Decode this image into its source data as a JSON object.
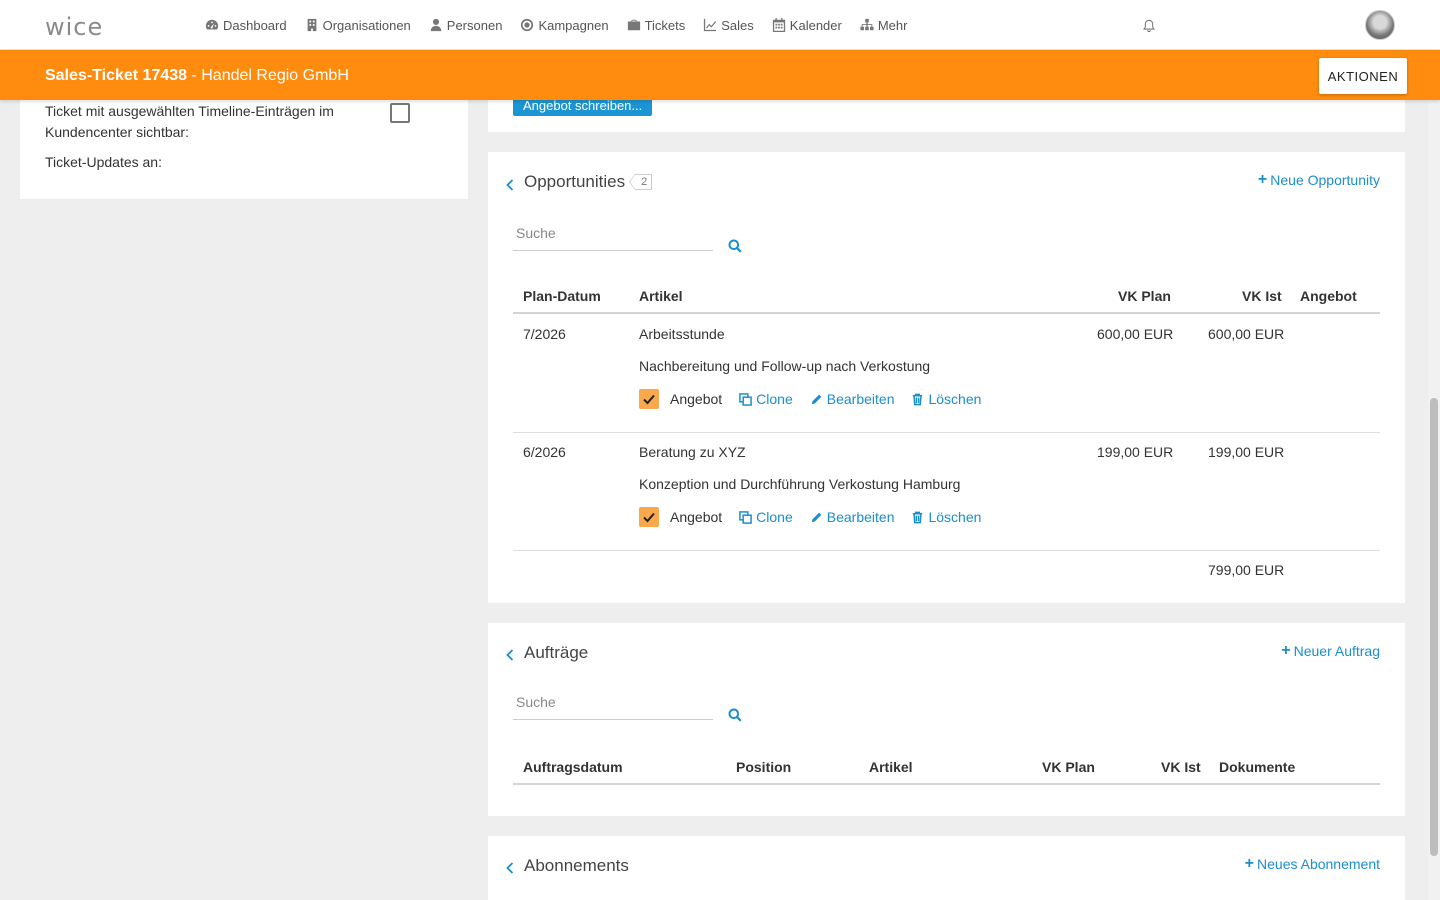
{
  "app": {
    "logo": "wice"
  },
  "nav": {
    "items": [
      {
        "label": "Dashboard",
        "icon": "dashboard-icon"
      },
      {
        "label": "Organisationen",
        "icon": "building-icon"
      },
      {
        "label": "Personen",
        "icon": "person-icon"
      },
      {
        "label": "Kampagnen",
        "icon": "target-icon"
      },
      {
        "label": "Tickets",
        "icon": "briefcase-icon"
      },
      {
        "label": "Sales",
        "icon": "chart-line-icon"
      },
      {
        "label": "Kalender",
        "icon": "calendar-icon"
      },
      {
        "label": "Mehr",
        "icon": "sitemap-icon"
      }
    ]
  },
  "ticket": {
    "title_bold": "Sales-Ticket 17438",
    "title_rest": " - Handel Regio GmbH",
    "actions_label": "AKTIONEN",
    "accent_color": "#ff8c0f"
  },
  "left_panel": {
    "visibility_label_line1": "Ticket mit ausgewählten Timeline-Einträgen im",
    "visibility_label_line2": "Kundencenter sichtbar:",
    "visibility_checked": false,
    "updates_label": "Ticket-Updates an:"
  },
  "top_card": {
    "write_offer_label": "Angebot schreiben..."
  },
  "opportunities": {
    "title": "Opportunities",
    "count": "2",
    "new_label": "Neue Opportunity",
    "search_placeholder": "Suche",
    "columns": [
      "Plan-Datum",
      "Artikel",
      "VK Plan",
      "VK Ist",
      "Angebot"
    ],
    "rows": [
      {
        "date": "7/2026",
        "article": "Arbeitsstunde",
        "description": "Nachbereitung und Follow-up nach Verkostung",
        "vk_plan": "600,00 EUR",
        "vk_ist": "600,00 EUR",
        "offer_label": "Angebot",
        "offer_checked": true,
        "clone_label": "Clone",
        "edit_label": "Bearbeiten",
        "delete_label": "Löschen"
      },
      {
        "date": "6/2026",
        "article": "Beratung zu XYZ",
        "description": "Konzeption und Durchführung Verkostung Hamburg",
        "vk_plan": "199,00 EUR",
        "vk_ist": "199,00 EUR",
        "offer_label": "Angebot",
        "offer_checked": true,
        "clone_label": "Clone",
        "edit_label": "Bearbeiten",
        "delete_label": "Löschen"
      }
    ],
    "total_vk_ist": "799,00 EUR"
  },
  "auftraege": {
    "title": "Aufträge",
    "new_label": "Neuer Auftrag",
    "search_placeholder": "Suche",
    "columns": [
      "Auftragsdatum",
      "Position",
      "Artikel",
      "VK Plan",
      "VK Ist",
      "Dokumente"
    ]
  },
  "abonnements": {
    "title": "Abonnements",
    "new_label": "Neues Abonnement"
  },
  "colors": {
    "link": "#1b8ecb",
    "checkbox_on": "#f9a94c",
    "button_blue": "#1c95d4"
  }
}
